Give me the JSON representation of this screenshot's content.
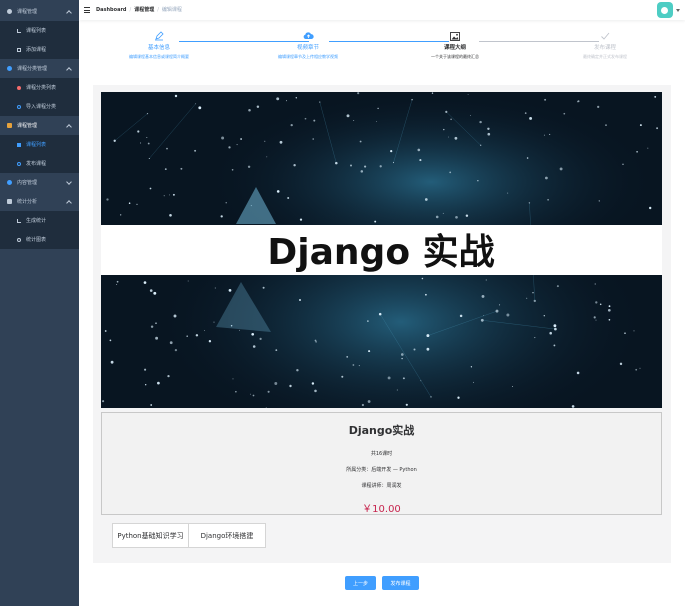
{
  "sidebar": {
    "groups": [
      {
        "label": "课程管理",
        "icon": "edit-icon",
        "icon_color": "#bfcbd9",
        "expanded": true,
        "items": [
          {
            "label": "课程列表"
          },
          {
            "label": "添加课程"
          }
        ]
      },
      {
        "label": "课程分类管理",
        "icon": "category-icon",
        "icon_color": "#409eff",
        "expanded": true,
        "items": [
          {
            "label": "课程分类列表"
          },
          {
            "label": "导入课程分类"
          }
        ]
      },
      {
        "label": "课程管理",
        "icon": "course-icon",
        "icon_color": "#e6a23c",
        "expanded": true,
        "items": [
          {
            "label": "课程列表"
          },
          {
            "label": "发布课程"
          }
        ]
      },
      {
        "label": "内容管理",
        "icon": "content-icon",
        "icon_color": "#409eff",
        "expanded": false,
        "items": []
      },
      {
        "label": "统计分析",
        "icon": "stats-icon",
        "icon_color": "#bfcbd9",
        "expanded": true,
        "items": [
          {
            "label": "生成统计"
          },
          {
            "label": "统计图表"
          }
        ]
      }
    ]
  },
  "navbar": {
    "breadcrumb": [
      "Dashboard",
      "课程管理",
      "编辑课程"
    ]
  },
  "steps": [
    {
      "title": "基本信息",
      "desc": "编辑课程基本信息或课程简介概要",
      "status": "done"
    },
    {
      "title": "视频章节",
      "desc": "编辑课程章节及上传相应教学视频",
      "status": "done"
    },
    {
      "title": "课程大纲",
      "desc": "一个关于该课程的最终汇总",
      "status": "process"
    },
    {
      "title": "发布课程",
      "desc": "最终确定并正式发布课程",
      "status": "wait"
    }
  ],
  "cover": {
    "text": "Django 实战"
  },
  "course": {
    "title": "Django实战",
    "lessons": "共16课时",
    "category": "所属分类：后端开发 — Python",
    "teacher": "课程讲师：周润发",
    "price": "￥10.00"
  },
  "chapters": [
    "Python基础知识学习",
    "Django环境搭建"
  ],
  "buttons": {
    "prev": "上一步",
    "publish": "发布课程"
  },
  "colors": {
    "primary": "#409eff",
    "sidebar_bg": "#304156",
    "price": "#c7254e"
  }
}
